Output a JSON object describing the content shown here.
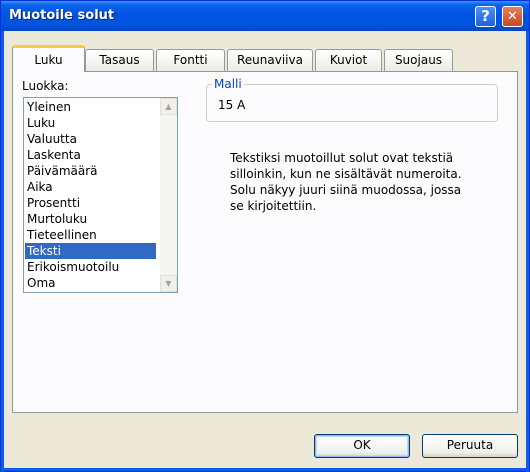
{
  "window": {
    "title": "Muotoile solut",
    "help_glyph": "?",
    "close_glyph": "✕"
  },
  "tabs": [
    {
      "label": "Luku",
      "active": true
    },
    {
      "label": "Tasaus",
      "active": false
    },
    {
      "label": "Fontti",
      "active": false
    },
    {
      "label": "Reunaviiva",
      "active": false
    },
    {
      "label": "Kuviot",
      "active": false
    },
    {
      "label": "Suojaus",
      "active": false
    }
  ],
  "category": {
    "label": "Luokka:",
    "items": [
      "Yleinen",
      "Luku",
      "Valuutta",
      "Laskenta",
      "Päivämäärä",
      "Aika",
      "Prosentti",
      "Murtoluku",
      "Tieteellinen",
      "Teksti",
      "Erikoismuotoilu",
      "Oma"
    ],
    "selected": "Teksti"
  },
  "sample": {
    "legend": "Malli",
    "value": "15 A"
  },
  "description": "Tekstiksi muotoillut solut ovat tekstiä silloinkin, kun ne sisältävät numeroita. Solu näkyy juuri siinä muodossa, jossa se kirjoitettiin.",
  "buttons": {
    "ok": "OK",
    "cancel": "Peruuta"
  },
  "colors": {
    "titlebar": "#0055E3",
    "selection": "#316AC5",
    "active_tab_accent": "#FFC83C",
    "group_legend": "#0046D5"
  }
}
